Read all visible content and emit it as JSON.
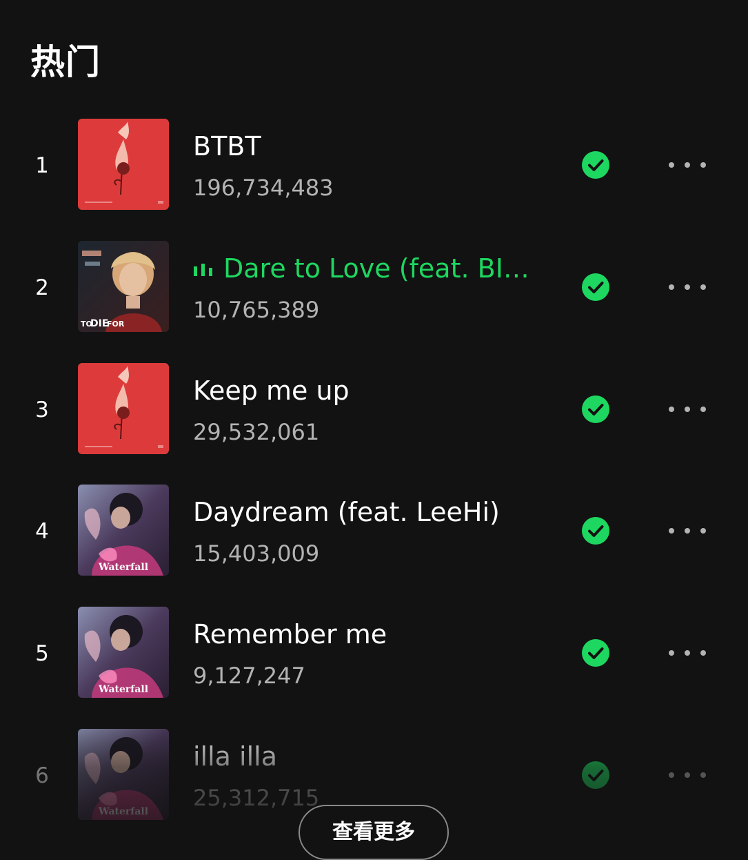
{
  "section": {
    "title": "热门"
  },
  "tracks": [
    {
      "rank": "1",
      "title": "BTBT",
      "plays": "196,734,483",
      "saved": true,
      "playing": false,
      "cover": "red-flower-cover"
    },
    {
      "rank": "2",
      "title": "Dare to Love (feat. BIG...",
      "plays": "10,765,389",
      "saved": true,
      "playing": true,
      "cover": "to-die-for-cover"
    },
    {
      "rank": "3",
      "title": "Keep me up",
      "plays": "29,532,061",
      "saved": true,
      "playing": false,
      "cover": "red-flower-cover"
    },
    {
      "rank": "4",
      "title": "Daydream (feat. LeeHi)",
      "plays": "15,403,009",
      "saved": true,
      "playing": false,
      "cover": "waterfall-cover"
    },
    {
      "rank": "5",
      "title": "Remember me",
      "plays": "9,127,247",
      "saved": true,
      "playing": false,
      "cover": "waterfall-cover"
    },
    {
      "rank": "6",
      "title": "illa illa",
      "plays": "25,312,715",
      "saved": true,
      "playing": false,
      "cover": "waterfall-cover"
    }
  ],
  "covers": {
    "to_die_for_text_1": "TO",
    "to_die_for_text_2": "DIE",
    "to_die_for_text_3": "FOR",
    "waterfall_text": "Waterfall"
  },
  "show_more": {
    "label": "查看更多"
  },
  "colors": {
    "background": "#121212",
    "accent_green": "#1ed760",
    "secondary_text": "#b3b3b3"
  },
  "icons": {
    "saved": "check-circle-icon",
    "more": "more-horizontal-icon",
    "playing": "equalizer-icon"
  }
}
